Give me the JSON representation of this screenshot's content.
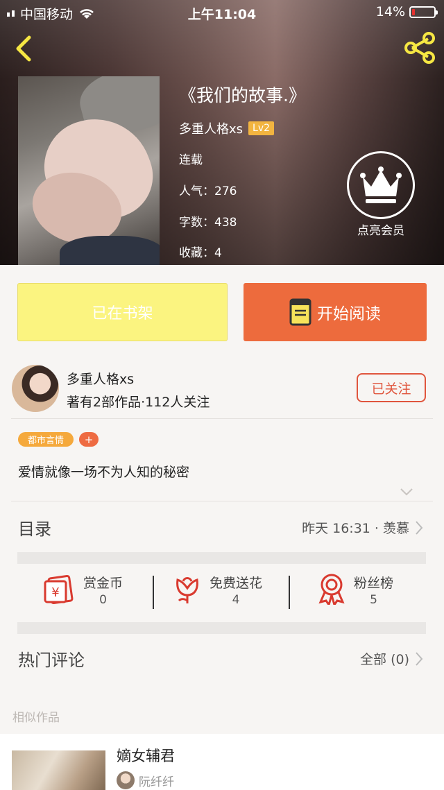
{
  "status_bar": {
    "carrier": "中国移动",
    "time": "上午11:04",
    "battery": "14%",
    "battery_level": 0.14
  },
  "book": {
    "title": "《我们的故事.》",
    "author": "多重人格xs",
    "level": "Lv2",
    "status": "连载",
    "popularity": "人气：276",
    "word_count": "字数：438",
    "favorites": "收藏：4"
  },
  "vip": {
    "label": "点亮会员"
  },
  "actions": {
    "shelf": "已在书架",
    "read": "开始阅读"
  },
  "author_card": {
    "name": "多重人格xs",
    "stats": "著有2部作品·112人关注",
    "follow": "已关注"
  },
  "tags": {
    "genre": "都市言情",
    "add": "+"
  },
  "synopsis": "爱情就像一场不为人知的秘密",
  "catalog": {
    "label": "目录",
    "update": "昨天 16:31 · 羡慕"
  },
  "rewards": [
    {
      "label": "赏金币",
      "count": "0",
      "icon": "red-envelope-icon"
    },
    {
      "label": "免费送花",
      "count": "4",
      "icon": "flower-icon"
    },
    {
      "label": "粉丝榜",
      "count": "5",
      "icon": "medal-icon"
    }
  ],
  "comments": {
    "label": "热门评论",
    "all": "全部 (0)"
  },
  "similar": {
    "label": "相似作品",
    "items": [
      {
        "title": "嫡女辅君",
        "author": "阮纤纤"
      }
    ]
  },
  "colors": {
    "accent": "#ed6b3d",
    "shelf": "#fbf480",
    "follow": "#e0553d",
    "badge": "#f2b440",
    "tag": "#f5a93c"
  }
}
